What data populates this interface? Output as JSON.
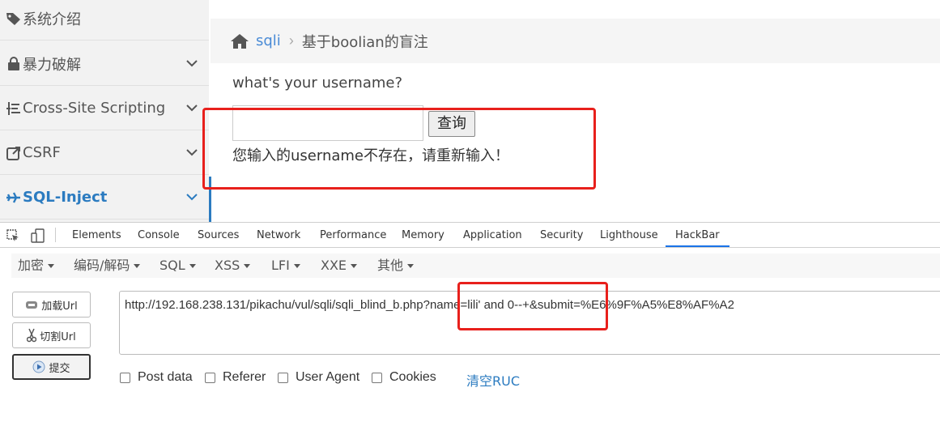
{
  "sidebar": {
    "items": [
      {
        "label": "系统介绍",
        "icon": "tag-icon"
      },
      {
        "label": "暴力破解",
        "icon": "lock-icon"
      },
      {
        "label": "Cross-Site Scripting",
        "icon": "tree-icon"
      },
      {
        "label": "CSRF",
        "icon": "external-link-icon"
      },
      {
        "label": "SQL-Inject",
        "icon": "plane-icon"
      }
    ],
    "active_color": "#2b7bc0"
  },
  "breadcrumb": {
    "link": "sqli",
    "separator": "›",
    "current": "基于boolian的盲注"
  },
  "main": {
    "question": "what's your username?",
    "input_value": "",
    "query_button": "查询",
    "result_message": "您输入的username不存在，请重新输入！"
  },
  "devtools": {
    "tabs": [
      "Elements",
      "Console",
      "Sources",
      "Network",
      "Performance",
      "Memory",
      "Application",
      "Security",
      "Lighthouse",
      "HackBar"
    ],
    "active_tab": "HackBar"
  },
  "hackbar": {
    "menus": [
      "加密",
      "编码/解码",
      "SQL",
      "XSS",
      "LFI",
      "XXE",
      "其他"
    ],
    "buttons": {
      "load": "加载Url",
      "split": "切割Url",
      "submit": "提交"
    },
    "url": "http://192.168.238.131/pikachu/vul/sqli/sqli_blind_b.php?name=lili' and 0--+&submit=%E6%9F%A5%E8%AF%A2",
    "checkboxes": [
      "Post data",
      "Referer",
      "User Agent",
      "Cookies"
    ],
    "clear_link": "清空RUC"
  },
  "colors": {
    "highlight": "#e8201c",
    "link": "#4a8bd6",
    "accent": "#1a73e8"
  }
}
